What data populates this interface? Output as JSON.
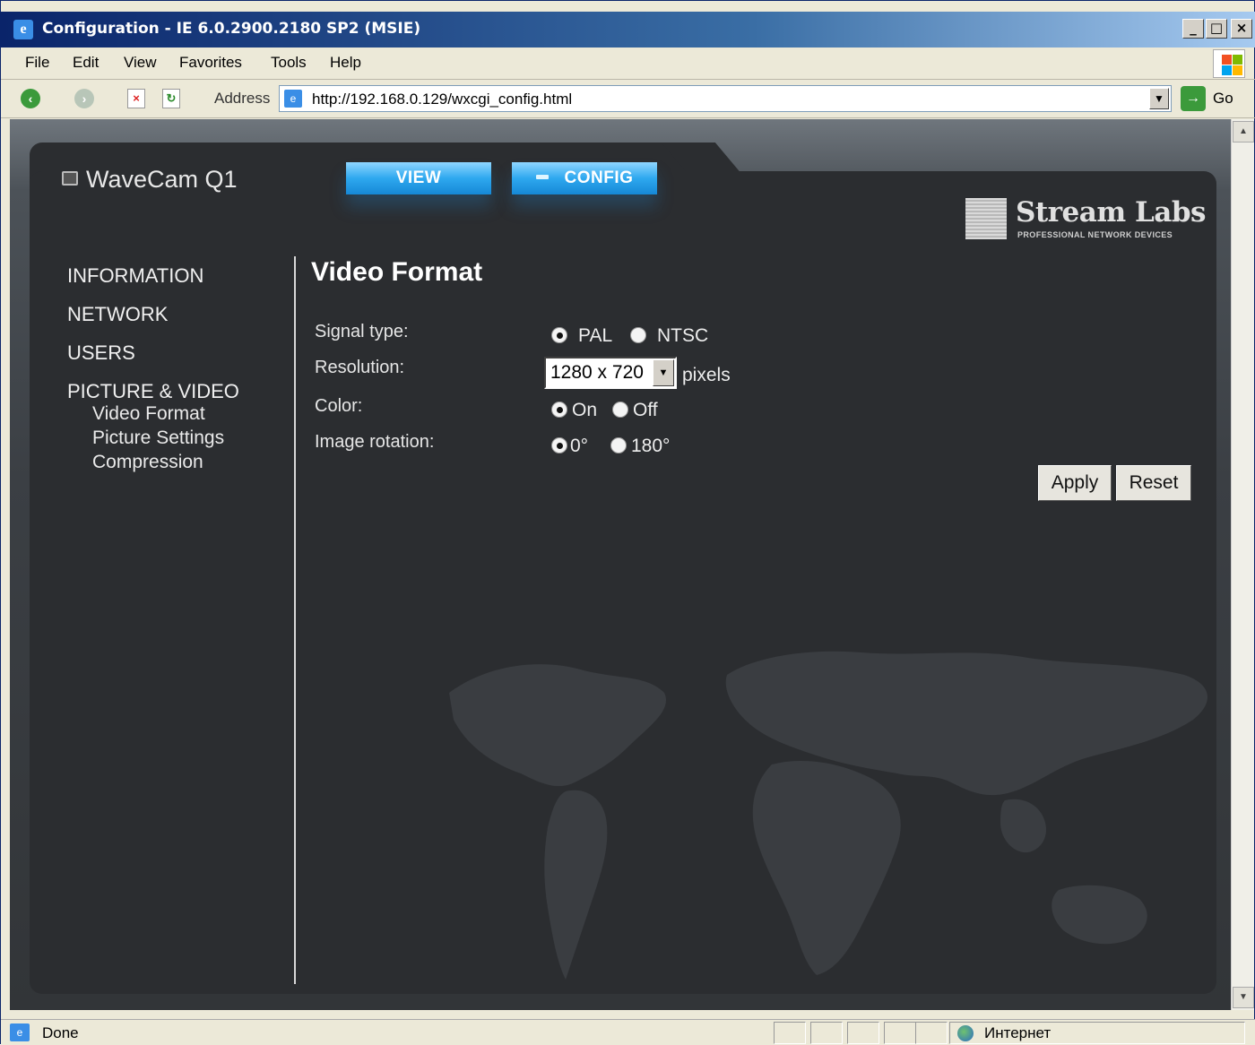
{
  "window": {
    "title": "Configuration - IE 6.0.2900.2180 SP2 (MSIE)",
    "min_label": "_",
    "max_label": "□",
    "close_label": "×"
  },
  "menu": {
    "items": [
      "File",
      "Edit",
      "View",
      "Favorites",
      "Tools",
      "Help"
    ]
  },
  "toolbar": {
    "address_label": "Address",
    "url": "http://192.168.0.129/wxcgi_config.html",
    "go_label": "Go"
  },
  "page": {
    "device_name": "WaveCam Q1",
    "nav": {
      "view_label": "VIEW",
      "config_label": "CONFIG"
    },
    "logo": {
      "name": "Stream Labs",
      "tagline": "PROFESSIONAL  NETWORK  DEVICES"
    },
    "sidebar": {
      "items": [
        "INFORMATION",
        "NETWORK",
        "USERS",
        "PICTURE & VIDEO"
      ],
      "subitems": [
        "Video Format",
        "Picture Settings",
        "Compression"
      ]
    },
    "content": {
      "title": "Video Format",
      "signal_type": {
        "label": "Signal type:",
        "options": [
          "PAL",
          "NTSC"
        ],
        "selected": "PAL"
      },
      "resolution": {
        "label": "Resolution:",
        "value": "1280 x 720",
        "unit": "pixels"
      },
      "color": {
        "label": "Color:",
        "options": [
          "On",
          "Off"
        ],
        "selected": "On"
      },
      "rotation": {
        "label": "Image rotation:",
        "options": [
          "0°",
          "180°"
        ],
        "selected": "0°"
      },
      "apply_label": "Apply",
      "reset_label": "Reset"
    }
  },
  "status": {
    "text": "Done",
    "zone": "Интернет"
  },
  "colors": {
    "panel_bg": "#2b2d30",
    "nav_blue": "#2ea8ef",
    "titlebar": "#0a246a"
  }
}
